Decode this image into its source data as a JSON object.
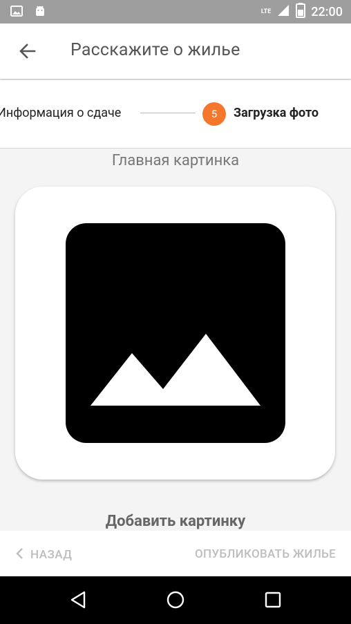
{
  "status_bar": {
    "time": "22:00",
    "network": "LTE",
    "icons": [
      "image-icon",
      "android-icon",
      "signal-icon",
      "battery-icon"
    ],
    "background": "#9e9e9e"
  },
  "app_bar": {
    "title": "Расскажите о жилье",
    "back_icon": "arrow-back-icon"
  },
  "stepper": {
    "previous_step_label": "Информация о сдаче",
    "current_step_number": "5",
    "current_step_label": "Загрузка фото",
    "accent_color": "#f5772e"
  },
  "main": {
    "section_title": "Главная картинка",
    "image_placeholder_icon": "image-icon",
    "add_image_label": "Добавить картинку"
  },
  "bottom_actions": {
    "back_label": "НАЗАД",
    "publish_label": "ОПУБЛИКОВАТЬ ЖИЛЬЕ"
  },
  "system_nav": {
    "icons": [
      "back-triangle-icon",
      "home-circle-icon",
      "recents-square-icon"
    ]
  }
}
